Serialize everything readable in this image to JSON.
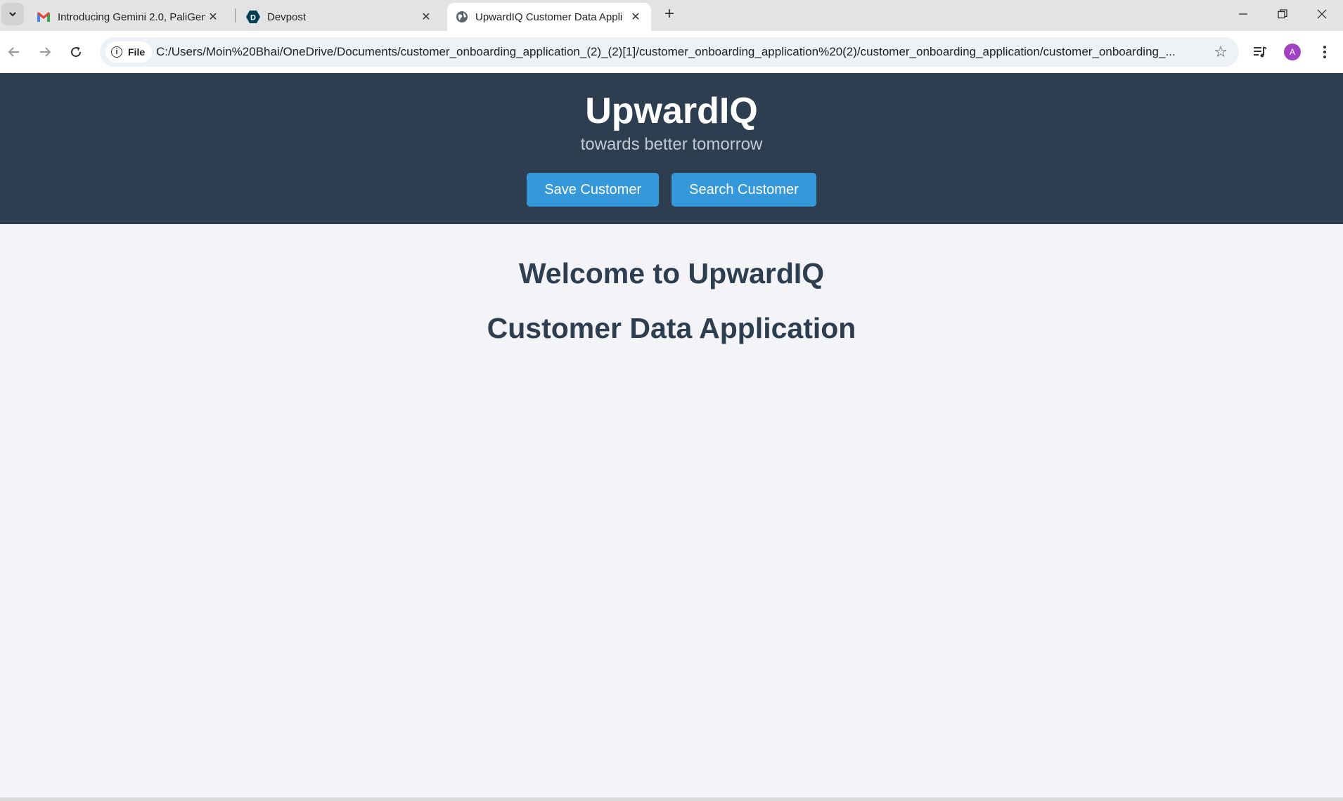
{
  "browser": {
    "tabs": [
      {
        "title": "Introducing Gemini 2.0, PaliGem",
        "icon": "gmail-icon",
        "active": false
      },
      {
        "title": "Devpost",
        "icon": "devpost-icon",
        "active": false
      },
      {
        "title": "UpwardIQ Customer Data Appli",
        "icon": "globe-icon",
        "active": true
      }
    ],
    "file_chip": "File",
    "url": "C:/Users/Moin%20Bhai/OneDrive/Documents/customer_onboarding_application_(2)_(2)[1]/customer_onboarding_application%20(2)/customer_onboarding_application/customer_onboarding_...",
    "avatar_letter": "A"
  },
  "header": {
    "brand": "UpwardIQ",
    "tagline": "towards better tomorrow",
    "buttons": {
      "save": "Save Customer",
      "search": "Search Customer"
    }
  },
  "main": {
    "welcome": "Welcome to UpwardIQ",
    "subtitle": "Customer Data Application"
  },
  "colors": {
    "header_bg": "#2c3e50",
    "button_bg": "#3498db",
    "page_bg": "#f4f3f8",
    "heading": "#2c3e50"
  }
}
